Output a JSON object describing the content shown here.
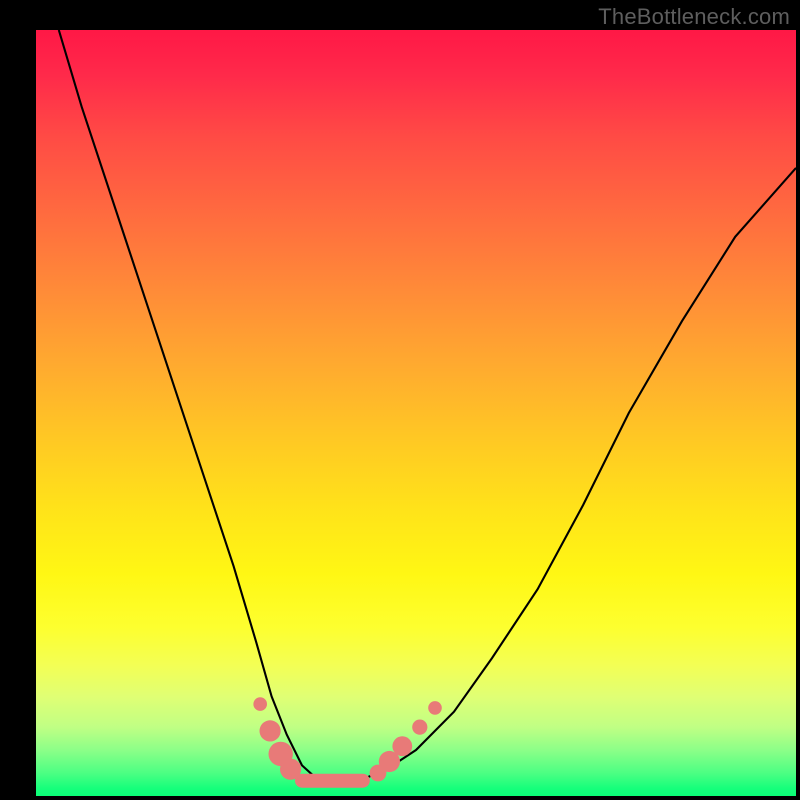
{
  "watermark": "TheBottleneck.com",
  "chart_data": {
    "type": "line",
    "title": "",
    "xlabel": "",
    "ylabel": "",
    "xlim": [
      0,
      100
    ],
    "ylim": [
      0,
      100
    ],
    "grid": false,
    "legend": false,
    "note": "Values estimated from pixel positions; no numeric tick labels are rendered in the source image.",
    "series": [
      {
        "name": "bottleneck-curve",
        "x": [
          3,
          6,
          10,
          14,
          18,
          22,
          26,
          29,
          31,
          33,
          35,
          37,
          39,
          41,
          43,
          46,
          50,
          55,
          60,
          66,
          72,
          78,
          85,
          92,
          100
        ],
        "y": [
          100,
          90,
          78,
          66,
          54,
          42,
          30,
          20,
          13,
          8,
          4,
          2.2,
          2,
          2,
          2.2,
          3.4,
          6,
          11,
          18,
          27,
          38,
          50,
          62,
          73,
          82
        ]
      }
    ],
    "markers": [
      {
        "x": 29.5,
        "y": 12.0,
        "r": 0.9
      },
      {
        "x": 30.8,
        "y": 8.5,
        "r": 1.4
      },
      {
        "x": 32.2,
        "y": 5.5,
        "r": 1.6
      },
      {
        "x": 33.5,
        "y": 3.5,
        "r": 1.4
      },
      {
        "x": 45.0,
        "y": 3.0,
        "r": 1.1
      },
      {
        "x": 46.5,
        "y": 4.5,
        "r": 1.4
      },
      {
        "x": 48.2,
        "y": 6.5,
        "r": 1.3
      },
      {
        "x": 50.5,
        "y": 9.0,
        "r": 1.0
      },
      {
        "x": 52.5,
        "y": 11.5,
        "r": 0.9
      }
    ],
    "flat_run": {
      "x0": 35.0,
      "x1": 43.0,
      "y": 2.0
    },
    "background_gradient": {
      "direction": "top-to-bottom",
      "stops": [
        {
          "pos": 0.0,
          "color": "#ff1846"
        },
        {
          "pos": 0.35,
          "color": "#ff8b38"
        },
        {
          "pos": 0.65,
          "color": "#ffe419"
        },
        {
          "pos": 0.9,
          "color": "#c0ff84"
        },
        {
          "pos": 1.0,
          "color": "#0aff76"
        }
      ]
    }
  }
}
